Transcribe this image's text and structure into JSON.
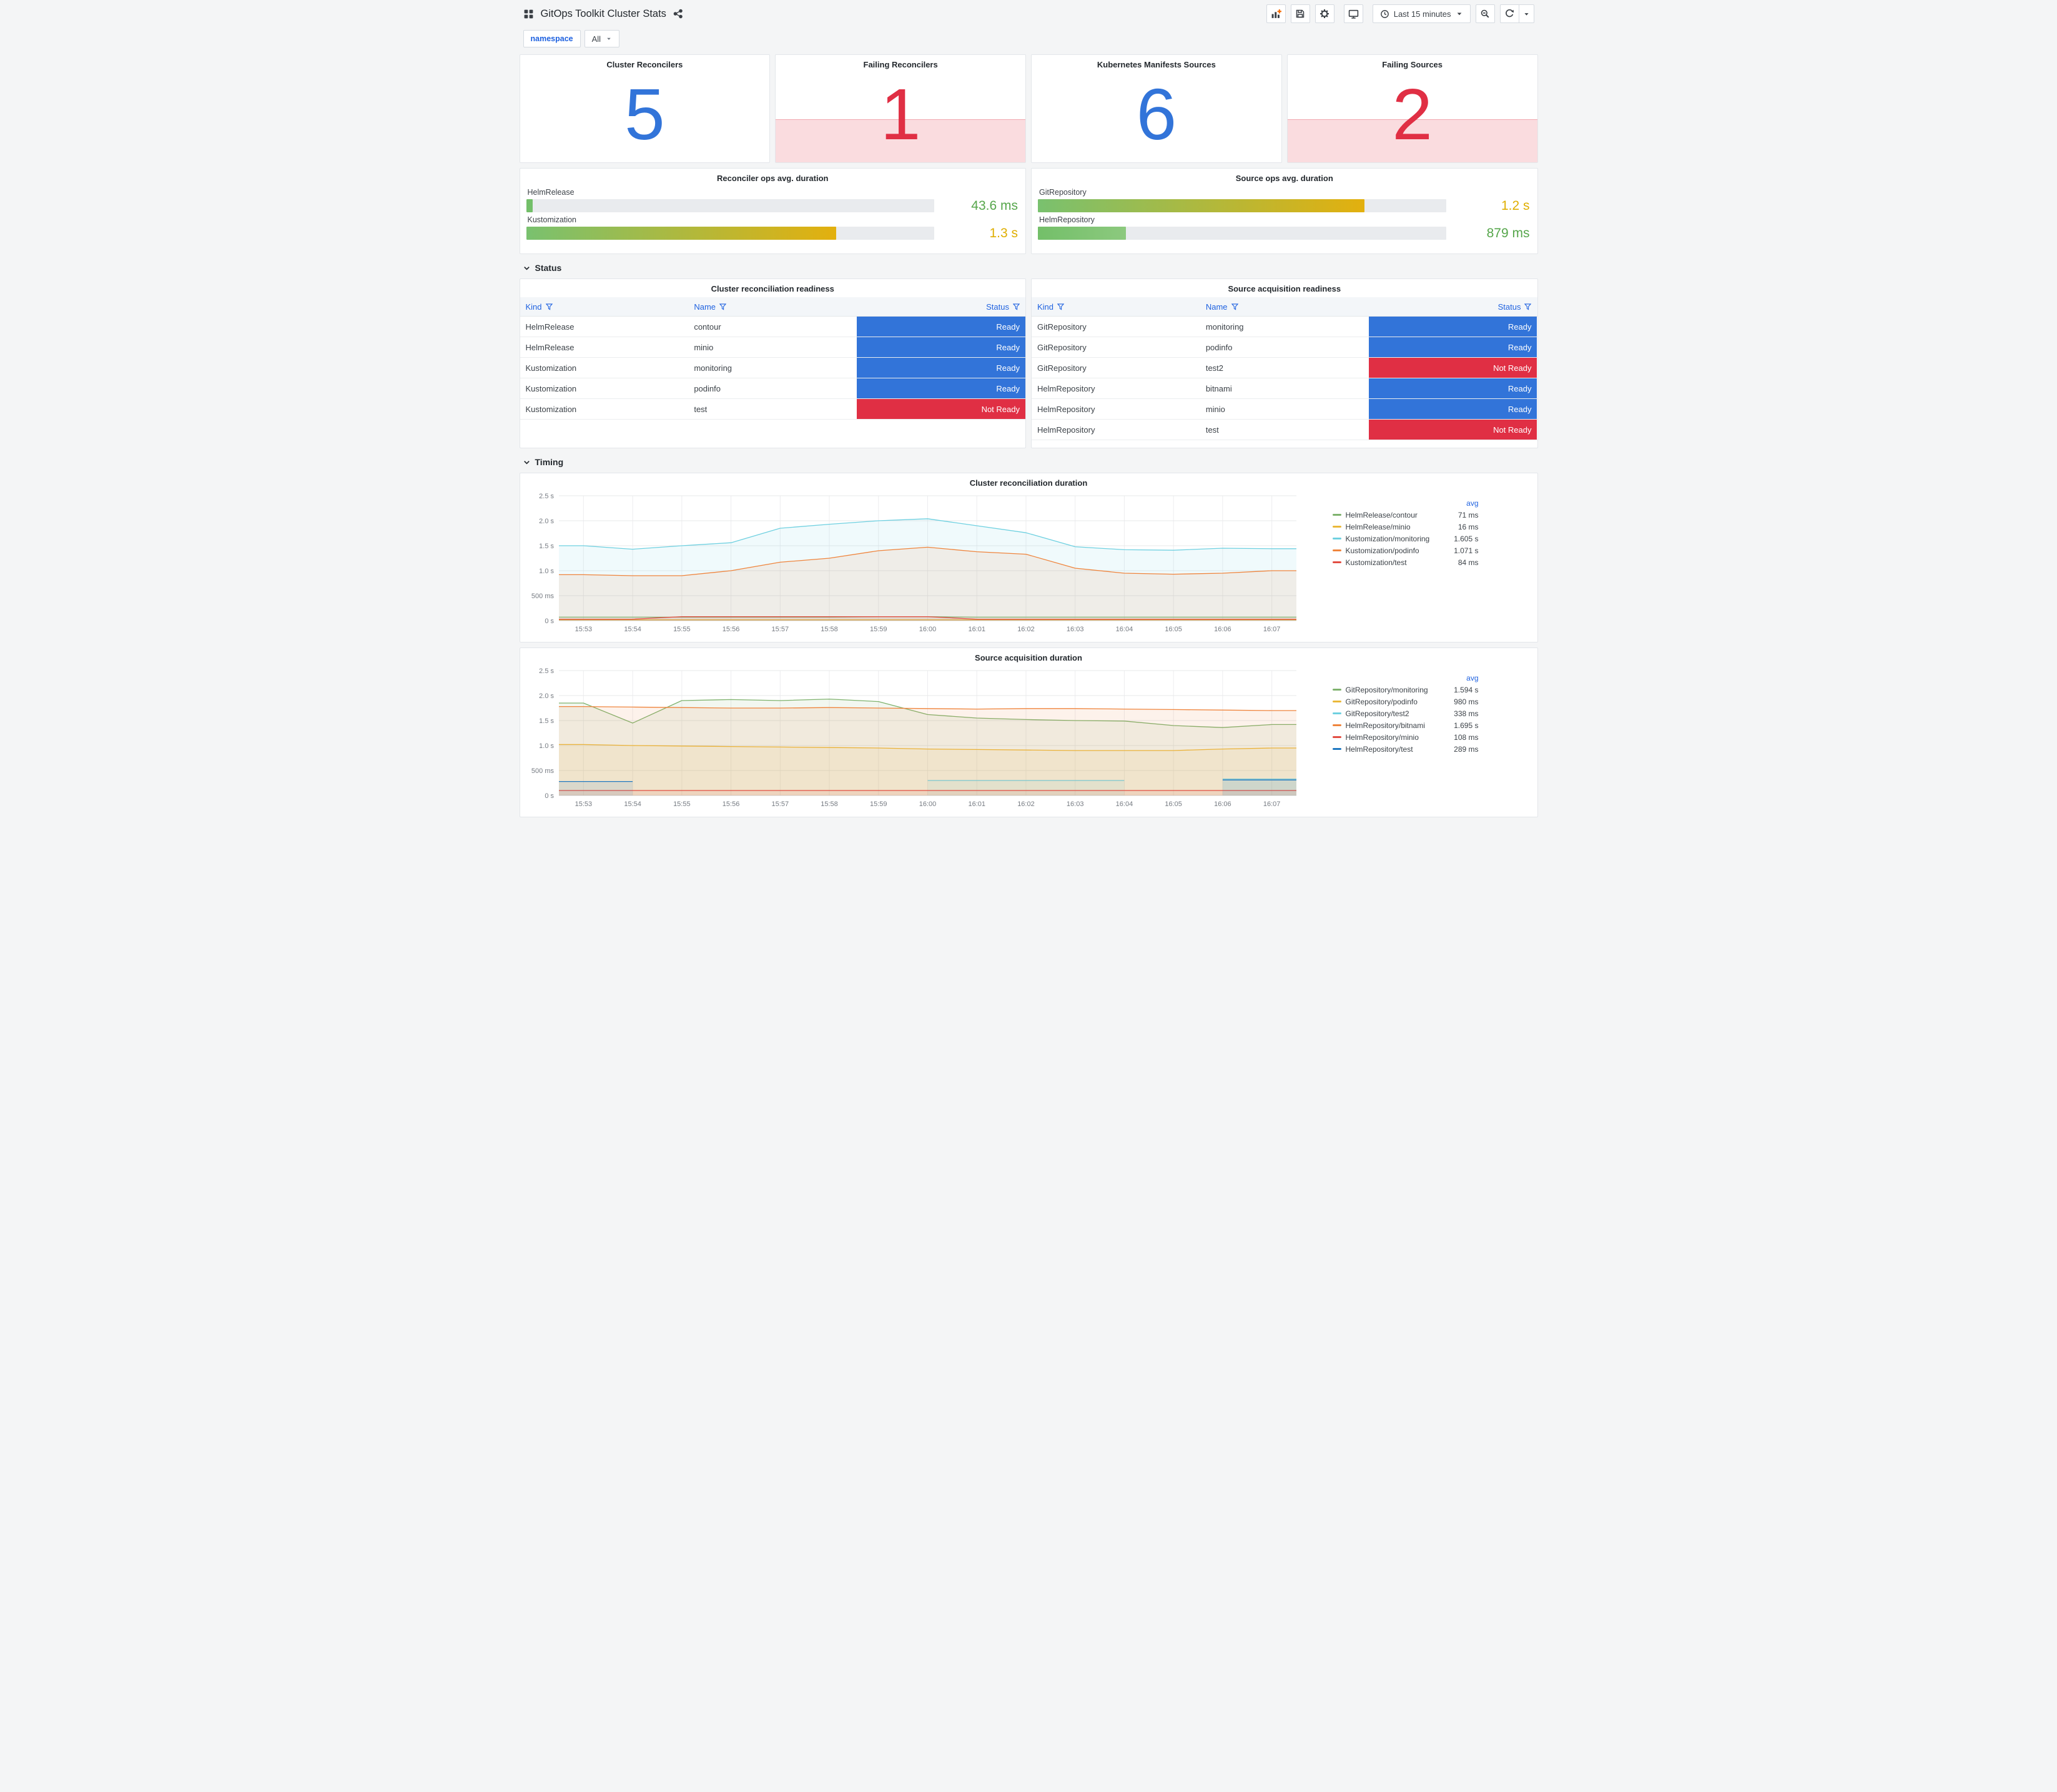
{
  "header": {
    "title": "GitOps Toolkit Cluster Stats",
    "time_picker": "Last 15 minutes"
  },
  "toolbar": {
    "icons": [
      "dashboards-grid",
      "share",
      "add-panel",
      "save-dashboard",
      "dashboard-settings",
      "cycle-view-mode",
      "clock",
      "zoom-out",
      "refresh",
      "refresh-interval-caret"
    ]
  },
  "variables": {
    "label": "namespace",
    "value": "All"
  },
  "colors": {
    "blue": "#3274d9",
    "red": "#e02f44",
    "green_text": "#56a64b",
    "yellow_text": "#dfae00",
    "link": "#1f62e0",
    "status": {
      "Ready": "#3274d9",
      "Not Ready": "#e02f44"
    }
  },
  "sections": {
    "status": "Status",
    "timing": "Timing"
  },
  "stats": [
    {
      "title": "Cluster Reconcilers",
      "value": "5",
      "state": "ok"
    },
    {
      "title": "Failing Reconcilers",
      "value": "1",
      "state": "alert"
    },
    {
      "title": "Kubernetes Manifests Sources",
      "value": "6",
      "state": "ok"
    },
    {
      "title": "Failing Sources",
      "value": "2",
      "state": "alert"
    }
  ],
  "gauges": [
    {
      "title": "Reconciler ops avg. duration",
      "bars": [
        {
          "label": "HelmRelease",
          "value": "43.6 ms",
          "pct": 1.6,
          "value_color": "#56a64b",
          "bar_from": "#73bf69",
          "bar_to": "#73bf69"
        },
        {
          "label": "Kustomization",
          "value": "1.3 s",
          "pct": 76,
          "value_color": "#dfae00",
          "bar_from": "#79c16f",
          "bar_to": "#e3b00e"
        }
      ]
    },
    {
      "title": "Source ops avg. duration",
      "bars": [
        {
          "label": "GitRepository",
          "value": "1.2 s",
          "pct": 80,
          "value_color": "#dfae00",
          "bar_from": "#79c16f",
          "bar_to": "#e3b00e"
        },
        {
          "label": "HelmRepository",
          "value": "879 ms",
          "pct": 21.5,
          "value_color": "#56a64b",
          "bar_from": "#73bf69",
          "bar_to": "#8cc97e"
        }
      ]
    }
  ],
  "tables": [
    {
      "title": "Cluster reconciliation readiness",
      "columns": [
        "Kind",
        "Name",
        "Status"
      ],
      "rows": [
        [
          "HelmRelease",
          "contour",
          "Ready"
        ],
        [
          "HelmRelease",
          "minio",
          "Ready"
        ],
        [
          "Kustomization",
          "monitoring",
          "Ready"
        ],
        [
          "Kustomization",
          "podinfo",
          "Ready"
        ],
        [
          "Kustomization",
          "test",
          "Not Ready"
        ]
      ]
    },
    {
      "title": "Source acquisition readiness",
      "columns": [
        "Kind",
        "Name",
        "Status"
      ],
      "rows": [
        [
          "GitRepository",
          "monitoring",
          "Ready"
        ],
        [
          "GitRepository",
          "podinfo",
          "Ready"
        ],
        [
          "GitRepository",
          "test2",
          "Not Ready"
        ],
        [
          "HelmRepository",
          "bitnami",
          "Ready"
        ],
        [
          "HelmRepository",
          "minio",
          "Ready"
        ],
        [
          "HelmRepository",
          "test",
          "Not Ready"
        ]
      ]
    }
  ],
  "chart_data": [
    {
      "type": "line",
      "title": "Cluster reconciliation duration",
      "x": [
        "15:53",
        "15:54",
        "15:55",
        "15:56",
        "15:57",
        "15:58",
        "15:59",
        "16:00",
        "16:01",
        "16:02",
        "16:03",
        "16:04",
        "16:05",
        "16:06",
        "16:07"
      ],
      "ylim": [
        0,
        2.5
      ],
      "yticks": [
        [
          0,
          "0 s"
        ],
        [
          0.5,
          "500 ms"
        ],
        [
          1,
          "1.0 s"
        ],
        [
          1.5,
          "1.5 s"
        ],
        [
          2,
          "2.0 s"
        ],
        [
          2.5,
          "2.5 s"
        ]
      ],
      "grid": true,
      "legend_position": "right",
      "legend_header": "avg",
      "series": [
        {
          "name": "HelmRelease/contour",
          "avg": "71 ms",
          "color": "#7eb26d",
          "values": [
            0.07,
            0.07,
            0.07,
            0.07,
            0.07,
            0.07,
            0.08,
            0.08,
            0.07,
            0.07,
            0.07,
            0.07,
            0.07,
            0.07,
            0.07
          ]
        },
        {
          "name": "HelmRelease/minio",
          "avg": "16 ms",
          "color": "#eab839",
          "values": [
            0.016,
            0.016,
            0.016,
            0.016,
            0.016,
            0.016,
            0.016,
            0.016,
            0.016,
            0.016,
            0.016,
            0.016,
            0.016,
            0.016,
            0.016
          ]
        },
        {
          "name": "Kustomization/monitoring",
          "avg": "1.605 s",
          "color": "#6ed0e0",
          "values": [
            1.5,
            1.43,
            1.5,
            1.56,
            1.85,
            1.93,
            2.0,
            2.04,
            1.9,
            1.76,
            1.48,
            1.42,
            1.41,
            1.45,
            1.44
          ]
        },
        {
          "name": "Kustomization/podinfo",
          "avg": "1.071 s",
          "color": "#ef843c",
          "values": [
            0.92,
            0.9,
            0.9,
            1.0,
            1.17,
            1.25,
            1.4,
            1.47,
            1.38,
            1.33,
            1.05,
            0.95,
            0.93,
            0.95,
            1.0
          ]
        },
        {
          "name": "Kustomization/test",
          "avg": "84 ms",
          "color": "#e24d42",
          "values": [
            0.03,
            0.03,
            0.08,
            0.08,
            0.08,
            0.08,
            0.08,
            0.08,
            0.03,
            0.03,
            0.03,
            0.03,
            0.03,
            0.03,
            0.03
          ]
        }
      ]
    },
    {
      "type": "line",
      "title": "Source acquisition duration",
      "x": [
        "15:53",
        "15:54",
        "15:55",
        "15:56",
        "15:57",
        "15:58",
        "15:59",
        "16:00",
        "16:01",
        "16:02",
        "16:03",
        "16:04",
        "16:05",
        "16:06",
        "16:07"
      ],
      "ylim": [
        0,
        2.5
      ],
      "yticks": [
        [
          0,
          "0 s"
        ],
        [
          0.5,
          "500 ms"
        ],
        [
          1,
          "1.0 s"
        ],
        [
          1.5,
          "1.5 s"
        ],
        [
          2,
          "2.0 s"
        ],
        [
          2.5,
          "2.5 s"
        ]
      ],
      "grid": true,
      "legend_position": "right",
      "legend_header": "avg",
      "series": [
        {
          "name": "GitRepository/monitoring",
          "avg": "1.594 s",
          "color": "#7eb26d",
          "values": [
            1.85,
            1.45,
            1.9,
            1.92,
            1.9,
            1.93,
            1.88,
            1.62,
            1.55,
            1.52,
            1.5,
            1.49,
            1.4,
            1.36,
            1.42
          ]
        },
        {
          "name": "GitRepository/podinfo",
          "avg": "980 ms",
          "color": "#eab839",
          "values": [
            1.02,
            1.0,
            0.99,
            0.98,
            0.97,
            0.96,
            0.95,
            0.93,
            0.92,
            0.91,
            0.9,
            0.9,
            0.9,
            0.93,
            0.95
          ]
        },
        {
          "name": "GitRepository/test2",
          "avg": "338 ms",
          "color": "#6ed0e0",
          "values": [
            null,
            null,
            null,
            null,
            null,
            null,
            null,
            0.3,
            0.3,
            0.3,
            0.3,
            0.3,
            null,
            0.33,
            0.33
          ]
        },
        {
          "name": "HelmRepository/bitnami",
          "avg": "1.695 s",
          "color": "#ef843c",
          "values": [
            1.78,
            1.77,
            1.76,
            1.75,
            1.75,
            1.76,
            1.75,
            1.74,
            1.73,
            1.74,
            1.74,
            1.73,
            1.72,
            1.71,
            1.7
          ]
        },
        {
          "name": "HelmRepository/minio",
          "avg": "108 ms",
          "color": "#e24d42",
          "values": [
            0.1,
            0.1,
            0.1,
            0.1,
            0.1,
            0.1,
            0.1,
            0.1,
            0.1,
            0.1,
            0.1,
            0.1,
            0.1,
            0.1,
            0.1
          ]
        },
        {
          "name": "HelmRepository/test",
          "avg": "289 ms",
          "color": "#1f78c1",
          "values": [
            0.28,
            0.28,
            null,
            null,
            null,
            null,
            null,
            null,
            null,
            null,
            null,
            null,
            null,
            0.31,
            0.31
          ]
        }
      ]
    }
  ]
}
